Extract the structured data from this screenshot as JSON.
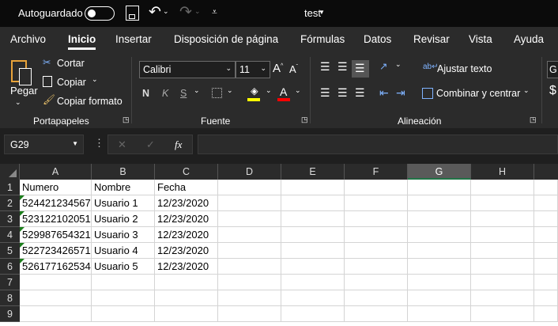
{
  "titlebar": {
    "autosave_label": "Autoguardado",
    "autosave_on": false,
    "doc_title": "test"
  },
  "tabs": [
    "Archivo",
    "Inicio",
    "Insertar",
    "Disposición de página",
    "Fórmulas",
    "Datos",
    "Revisar",
    "Vista",
    "Ayuda"
  ],
  "active_tab": "Inicio",
  "ribbon": {
    "clipboard": {
      "paste": "Pegar",
      "cut": "Cortar",
      "copy": "Copiar",
      "format_painter": "Copiar formato",
      "group": "Portapapeles"
    },
    "font": {
      "name": "Calibri",
      "size": "11",
      "bold": "N",
      "italic": "K",
      "underline": "S",
      "group": "Fuente",
      "fill_color": "#ffff00",
      "font_color": "#ff0000"
    },
    "alignment": {
      "wrap": "Ajustar texto",
      "merge": "Combinar y centrar",
      "group": "Alineación"
    },
    "number": {
      "format_partial": "G",
      "currency_partial": "$"
    }
  },
  "formula_bar": {
    "name_box": "G29",
    "cancel": "✕",
    "enter": "✓",
    "fx": "fx",
    "formula": ""
  },
  "sheet": {
    "columns": [
      "A",
      "B",
      "C",
      "D",
      "E",
      "F",
      "G",
      "H"
    ],
    "selected_column": "G",
    "rows": [
      "1",
      "2",
      "3",
      "4",
      "5",
      "6",
      "7",
      "8",
      "9"
    ],
    "cells": [
      [
        "Numero",
        "Nombre",
        "Fecha"
      ],
      [
        "524421234567",
        "Usuario 1",
        "12/23/2020"
      ],
      [
        "523122102051",
        "Usuario 2",
        "12/23/2020"
      ],
      [
        "529987654321",
        "Usuario 3",
        "12/23/2020"
      ],
      [
        "522723426571",
        "Usuario 4",
        "12/23/2020"
      ],
      [
        "526177162534",
        "Usuario 5",
        "12/23/2020"
      ]
    ],
    "error_indicator_color": "#1b7d1b"
  }
}
